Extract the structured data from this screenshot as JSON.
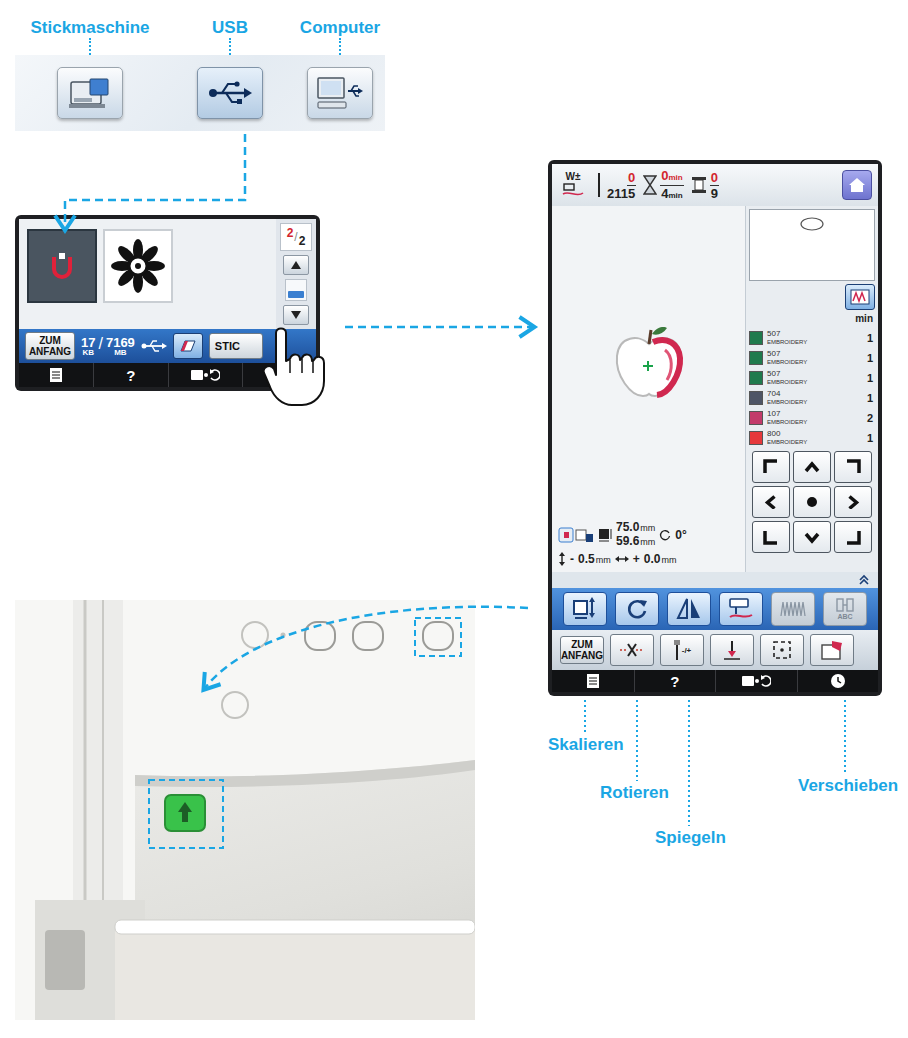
{
  "sources": [
    {
      "label": "Stickmaschine",
      "kind": "machine",
      "selected": false
    },
    {
      "label": "USB",
      "kind": "usb",
      "selected": true
    },
    {
      "label": "Computer",
      "kind": "computer",
      "selected": false
    }
  ],
  "usb_screen": {
    "thumbnails": [
      {
        "kind": "hoop",
        "selected": true
      },
      {
        "kind": "flower",
        "selected": false
      }
    ],
    "page": {
      "current": "2",
      "total": "2"
    },
    "home_button": "ZUM ANFANG",
    "storage": {
      "used": "17",
      "used_unit": "KB",
      "separator": "/",
      "free": "7169",
      "free_unit": "MB"
    },
    "sew_button": "STIC",
    "nav": [
      {
        "kind": "doc"
      },
      {
        "kind": "help",
        "label": "?"
      },
      {
        "kind": "settings"
      },
      {
        "kind": "clock"
      }
    ]
  },
  "embroidery_screen": {
    "presser_label": "W±",
    "stitches": {
      "current": "0",
      "total": "2115"
    },
    "time": {
      "current": "0",
      "total": "4",
      "unit": "min"
    },
    "colors": {
      "current": "0",
      "total": "9"
    },
    "min_label": "min",
    "threads": [
      {
        "code": "507",
        "brand": "EMBROIDERY",
        "minutes": "1",
        "color": "#1f7a4d"
      },
      {
        "code": "507",
        "brand": "EMBROIDERY",
        "minutes": "1",
        "color": "#1f7a4d"
      },
      {
        "code": "507",
        "brand": "EMBROIDERY",
        "minutes": "1",
        "color": "#1f7a4d"
      },
      {
        "code": "704",
        "brand": "EMBROIDERY",
        "minutes": "1",
        "color": "#4e5566"
      },
      {
        "code": "107",
        "brand": "EMBROIDERY",
        "minutes": "2",
        "color": "#c23a6a"
      },
      {
        "code": "800",
        "brand": "EMBROIDERY",
        "minutes": "1",
        "color": "#e5383b"
      }
    ],
    "size": {
      "width": "75.0",
      "height": "59.6",
      "unit": "mm",
      "angle": "0°"
    },
    "offset": {
      "v_sign": "-",
      "v_value": "0.5",
      "h_sign": "+",
      "h_value": "0.0",
      "unit": "mm"
    },
    "tools": [
      {
        "kind": "scale",
        "disabled": false
      },
      {
        "kind": "rotate",
        "disabled": false
      },
      {
        "kind": "mirror",
        "disabled": false
      },
      {
        "kind": "hoop",
        "disabled": false
      },
      {
        "kind": "density",
        "disabled": true
      },
      {
        "kind": "letters",
        "label": "ABC",
        "disabled": true
      }
    ],
    "actions": [
      {
        "kind": "home",
        "label": "ZUM ANFANG"
      },
      {
        "kind": "trim"
      },
      {
        "kind": "needle",
        "label": "-/+"
      },
      {
        "kind": "start"
      },
      {
        "kind": "frame"
      },
      {
        "kind": "memory"
      }
    ],
    "nav": [
      {
        "kind": "doc"
      },
      {
        "kind": "help",
        "label": "?"
      },
      {
        "kind": "settings"
      },
      {
        "kind": "clock"
      }
    ]
  },
  "callouts": [
    {
      "label": "Skalieren"
    },
    {
      "label": "Rotieren"
    },
    {
      "label": "Spiegeln"
    },
    {
      "label": "Verschieben"
    }
  ]
}
